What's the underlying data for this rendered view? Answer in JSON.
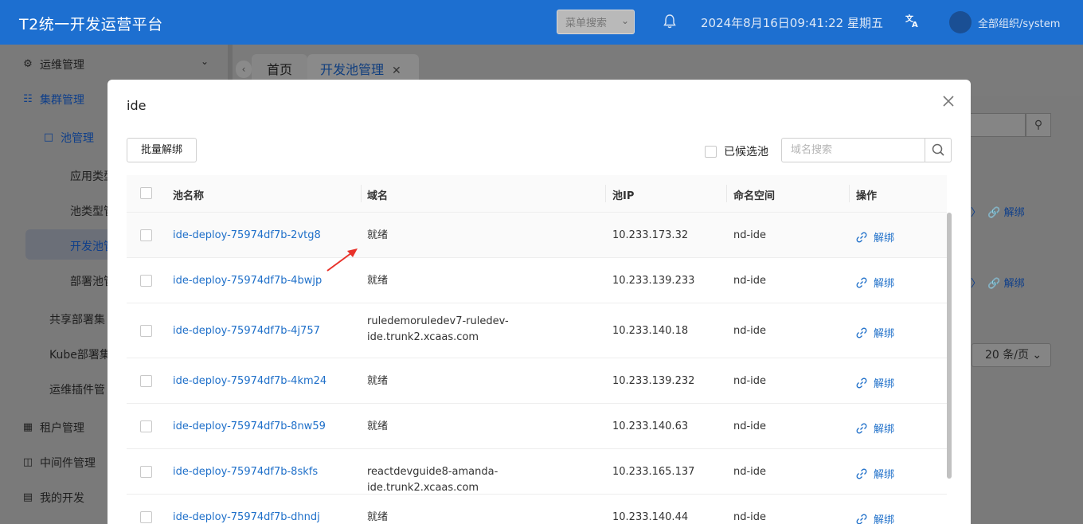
{
  "header": {
    "logo": "T2统一开发运营平台",
    "menu_search": "菜单搜索",
    "datetime": "2024年8月16日09:41:22 星期五",
    "org": "全部组织/system",
    "lang_icon": "文A"
  },
  "sidebar": {
    "items": [
      {
        "label": "运维管理",
        "icon": "gear-icon"
      },
      {
        "label": "集群管理",
        "icon": "cluster-icon"
      },
      {
        "label": "池管理",
        "icon": "folder-icon"
      },
      {
        "label": "应用类型"
      },
      {
        "label": "池类型管"
      },
      {
        "label": "开发池管"
      },
      {
        "label": "部署池管"
      },
      {
        "label": "共享部署集"
      },
      {
        "label": "Kube部署集"
      },
      {
        "label": "运维插件管"
      },
      {
        "label": "租户管理",
        "icon": "tenant-icon"
      },
      {
        "label": "中间件管理",
        "icon": "middleware-icon"
      },
      {
        "label": "我的开发",
        "icon": "dev-icon"
      }
    ]
  },
  "tabs": [
    {
      "label": "首页"
    },
    {
      "label": "开发池管理"
    }
  ],
  "background": {
    "row_action": "解绑",
    "page_size": "20 条/页"
  },
  "modal": {
    "title": "ide",
    "bulk_unbind": "批量解绑",
    "candidate_pool": "已候选池",
    "search_placeholder": "域名搜索",
    "columns": [
      "池名称",
      "域名",
      "池IP",
      "命名空间",
      "操作"
    ],
    "rows": [
      {
        "name": "ide-deploy-75974df7b-2vtg8",
        "domain": "就绪",
        "ip": "10.233.173.32",
        "ns": "nd-ide",
        "op": "解绑"
      },
      {
        "name": "ide-deploy-75974df7b-4bwjp",
        "domain": "就绪",
        "ip": "10.233.139.233",
        "ns": "nd-ide",
        "op": "解绑"
      },
      {
        "name": "ide-deploy-75974df7b-4j757",
        "domain": "ruledemoruledev7-ruledev-ide.trunk2.xcaas.com",
        "ip": "10.233.140.18",
        "ns": "nd-ide",
        "op": "解绑"
      },
      {
        "name": "ide-deploy-75974df7b-4km24",
        "domain": "就绪",
        "ip": "10.233.139.232",
        "ns": "nd-ide",
        "op": "解绑"
      },
      {
        "name": "ide-deploy-75974df7b-8nw59",
        "domain": "就绪",
        "ip": "10.233.140.63",
        "ns": "nd-ide",
        "op": "解绑"
      },
      {
        "name": "ide-deploy-75974df7b-8skfs",
        "domain": "reactdevguide8-amanda-ide.trunk2.xcaas.com",
        "ip": "10.233.165.137",
        "ns": "nd-ide",
        "op": "解绑"
      },
      {
        "name": "ide-deploy-75974df7b-dhndj",
        "domain": "就绪",
        "ip": "10.233.140.44",
        "ns": "nd-ide",
        "op": "解绑"
      }
    ]
  },
  "colors": {
    "header_bg": "#1d6fd0",
    "link": "#1e6fc9",
    "annotation_arrow": "#e8322a"
  }
}
